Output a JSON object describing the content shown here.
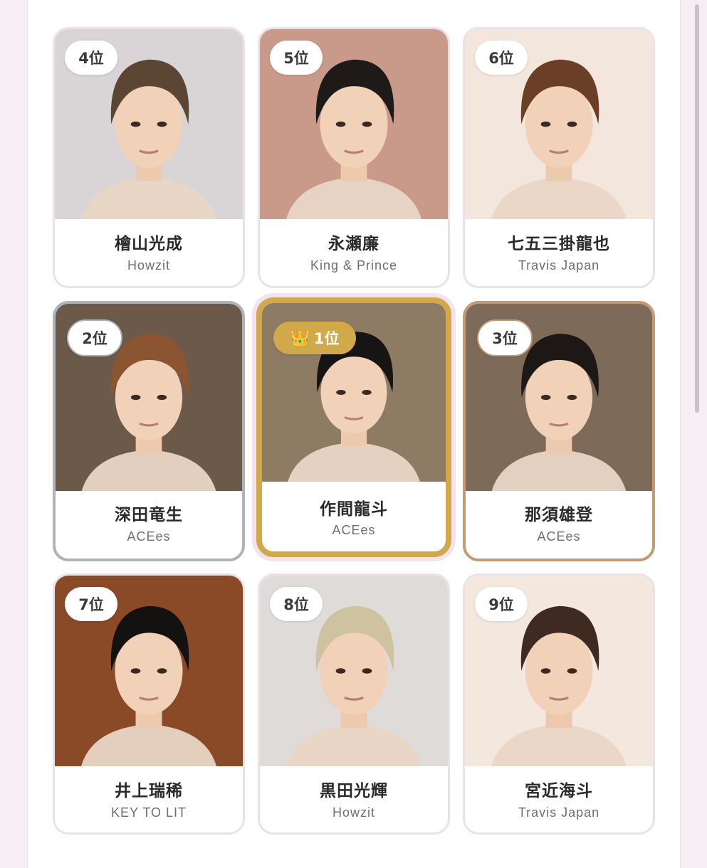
{
  "cards": [
    {
      "rank_label": "4位",
      "name": "檜山光成",
      "group": "Howzit",
      "tone": "#d9d4d6",
      "hair": "#5a4632"
    },
    {
      "rank_label": "5位",
      "name": "永瀬廉",
      "group": "King & Prince",
      "tone": "#c99a8a",
      "hair": "#1e1a19"
    },
    {
      "rank_label": "6位",
      "name": "七五三掛龍也",
      "group": "Travis Japan",
      "tone": "#f3e6dc",
      "hair": "#6a3f25"
    },
    {
      "rank_label": "2位",
      "name": "深田竜生",
      "group": "ACEes",
      "tone": "#6b5a4a",
      "hair": "#8a5530"
    },
    {
      "rank_label": "1位",
      "crown": "👑",
      "name": "作間龍斗",
      "group": "ACEes",
      "tone": "#8e7b63",
      "hair": "#171414"
    },
    {
      "rank_label": "3位",
      "name": "那須雄登",
      "group": "ACEes",
      "tone": "#7e6a58",
      "hair": "#1d1816"
    },
    {
      "rank_label": "7位",
      "name": "井上瑞稀",
      "group": "KEY TO LIT",
      "tone": "#8a4a28",
      "hair": "#141111"
    },
    {
      "rank_label": "8位",
      "name": "黒田光輝",
      "group": "Howzit",
      "tone": "#dedbd8",
      "hair": "#cfc2a0"
    },
    {
      "rank_label": "9位",
      "name": "宮近海斗",
      "group": "Travis Japan",
      "tone": "#f4e7de",
      "hair": "#3e2a20"
    }
  ]
}
